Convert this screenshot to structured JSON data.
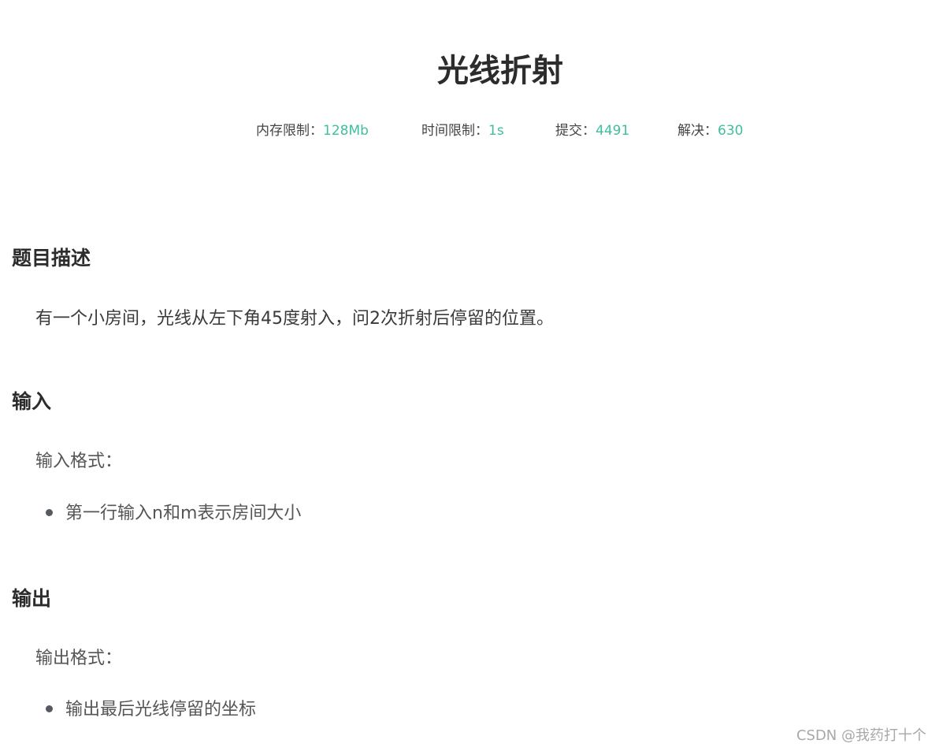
{
  "title": "光线折射",
  "stats": [
    {
      "label": "内存限制：",
      "value": "128Mb"
    },
    {
      "label": "时间限制：",
      "value": "1s"
    },
    {
      "label": "提交：",
      "value": "4491"
    },
    {
      "label": "解决：",
      "value": "630"
    }
  ],
  "description": {
    "heading": "题目描述",
    "text": "有一个小房间，光线从左下角45度射入，问2次折射后停留的位置。"
  },
  "input": {
    "heading": "输入",
    "format_label": "输入格式：",
    "items": [
      "第一行输入n和m表示房间大小"
    ]
  },
  "output": {
    "heading": "输出",
    "format_label": "输出格式：",
    "items": [
      "输出最后光线停留的坐标"
    ]
  },
  "watermark": "CSDN @我药打十个",
  "colors": {
    "accent": "#3fbf9f",
    "text": "#333333",
    "watermark": "#a8a8a8"
  }
}
